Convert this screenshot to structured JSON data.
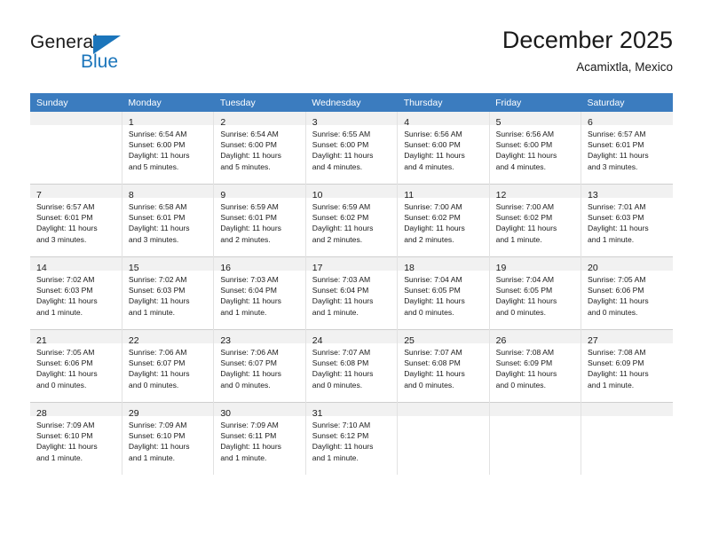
{
  "brand": {
    "name_top": "General",
    "name_bottom": "Blue",
    "accent_color": "#1b75bb"
  },
  "header": {
    "title": "December 2025",
    "subtitle": "Acamixtla, Mexico"
  },
  "theme": {
    "header_row_bg": "#3b7cbf",
    "header_row_text": "#ffffff",
    "daynum_band_bg": "#f1f1f1",
    "grid_line": "#e2e2e2"
  },
  "weekdays": [
    "Sunday",
    "Monday",
    "Tuesday",
    "Wednesday",
    "Thursday",
    "Friday",
    "Saturday"
  ],
  "weeks": [
    [
      {
        "day": "",
        "lines": []
      },
      {
        "day": "1",
        "lines": [
          "Sunrise: 6:54 AM",
          "Sunset: 6:00 PM",
          "Daylight: 11 hours",
          "and 5 minutes."
        ]
      },
      {
        "day": "2",
        "lines": [
          "Sunrise: 6:54 AM",
          "Sunset: 6:00 PM",
          "Daylight: 11 hours",
          "and 5 minutes."
        ]
      },
      {
        "day": "3",
        "lines": [
          "Sunrise: 6:55 AM",
          "Sunset: 6:00 PM",
          "Daylight: 11 hours",
          "and 4 minutes."
        ]
      },
      {
        "day": "4",
        "lines": [
          "Sunrise: 6:56 AM",
          "Sunset: 6:00 PM",
          "Daylight: 11 hours",
          "and 4 minutes."
        ]
      },
      {
        "day": "5",
        "lines": [
          "Sunrise: 6:56 AM",
          "Sunset: 6:00 PM",
          "Daylight: 11 hours",
          "and 4 minutes."
        ]
      },
      {
        "day": "6",
        "lines": [
          "Sunrise: 6:57 AM",
          "Sunset: 6:01 PM",
          "Daylight: 11 hours",
          "and 3 minutes."
        ]
      }
    ],
    [
      {
        "day": "7",
        "lines": [
          "Sunrise: 6:57 AM",
          "Sunset: 6:01 PM",
          "Daylight: 11 hours",
          "and 3 minutes."
        ]
      },
      {
        "day": "8",
        "lines": [
          "Sunrise: 6:58 AM",
          "Sunset: 6:01 PM",
          "Daylight: 11 hours",
          "and 3 minutes."
        ]
      },
      {
        "day": "9",
        "lines": [
          "Sunrise: 6:59 AM",
          "Sunset: 6:01 PM",
          "Daylight: 11 hours",
          "and 2 minutes."
        ]
      },
      {
        "day": "10",
        "lines": [
          "Sunrise: 6:59 AM",
          "Sunset: 6:02 PM",
          "Daylight: 11 hours",
          "and 2 minutes."
        ]
      },
      {
        "day": "11",
        "lines": [
          "Sunrise: 7:00 AM",
          "Sunset: 6:02 PM",
          "Daylight: 11 hours",
          "and 2 minutes."
        ]
      },
      {
        "day": "12",
        "lines": [
          "Sunrise: 7:00 AM",
          "Sunset: 6:02 PM",
          "Daylight: 11 hours",
          "and 1 minute."
        ]
      },
      {
        "day": "13",
        "lines": [
          "Sunrise: 7:01 AM",
          "Sunset: 6:03 PM",
          "Daylight: 11 hours",
          "and 1 minute."
        ]
      }
    ],
    [
      {
        "day": "14",
        "lines": [
          "Sunrise: 7:02 AM",
          "Sunset: 6:03 PM",
          "Daylight: 11 hours",
          "and 1 minute."
        ]
      },
      {
        "day": "15",
        "lines": [
          "Sunrise: 7:02 AM",
          "Sunset: 6:03 PM",
          "Daylight: 11 hours",
          "and 1 minute."
        ]
      },
      {
        "day": "16",
        "lines": [
          "Sunrise: 7:03 AM",
          "Sunset: 6:04 PM",
          "Daylight: 11 hours",
          "and 1 minute."
        ]
      },
      {
        "day": "17",
        "lines": [
          "Sunrise: 7:03 AM",
          "Sunset: 6:04 PM",
          "Daylight: 11 hours",
          "and 1 minute."
        ]
      },
      {
        "day": "18",
        "lines": [
          "Sunrise: 7:04 AM",
          "Sunset: 6:05 PM",
          "Daylight: 11 hours",
          "and 0 minutes."
        ]
      },
      {
        "day": "19",
        "lines": [
          "Sunrise: 7:04 AM",
          "Sunset: 6:05 PM",
          "Daylight: 11 hours",
          "and 0 minutes."
        ]
      },
      {
        "day": "20",
        "lines": [
          "Sunrise: 7:05 AM",
          "Sunset: 6:06 PM",
          "Daylight: 11 hours",
          "and 0 minutes."
        ]
      }
    ],
    [
      {
        "day": "21",
        "lines": [
          "Sunrise: 7:05 AM",
          "Sunset: 6:06 PM",
          "Daylight: 11 hours",
          "and 0 minutes."
        ]
      },
      {
        "day": "22",
        "lines": [
          "Sunrise: 7:06 AM",
          "Sunset: 6:07 PM",
          "Daylight: 11 hours",
          "and 0 minutes."
        ]
      },
      {
        "day": "23",
        "lines": [
          "Sunrise: 7:06 AM",
          "Sunset: 6:07 PM",
          "Daylight: 11 hours",
          "and 0 minutes."
        ]
      },
      {
        "day": "24",
        "lines": [
          "Sunrise: 7:07 AM",
          "Sunset: 6:08 PM",
          "Daylight: 11 hours",
          "and 0 minutes."
        ]
      },
      {
        "day": "25",
        "lines": [
          "Sunrise: 7:07 AM",
          "Sunset: 6:08 PM",
          "Daylight: 11 hours",
          "and 0 minutes."
        ]
      },
      {
        "day": "26",
        "lines": [
          "Sunrise: 7:08 AM",
          "Sunset: 6:09 PM",
          "Daylight: 11 hours",
          "and 0 minutes."
        ]
      },
      {
        "day": "27",
        "lines": [
          "Sunrise: 7:08 AM",
          "Sunset: 6:09 PM",
          "Daylight: 11 hours",
          "and 1 minute."
        ]
      }
    ],
    [
      {
        "day": "28",
        "lines": [
          "Sunrise: 7:09 AM",
          "Sunset: 6:10 PM",
          "Daylight: 11 hours",
          "and 1 minute."
        ]
      },
      {
        "day": "29",
        "lines": [
          "Sunrise: 7:09 AM",
          "Sunset: 6:10 PM",
          "Daylight: 11 hours",
          "and 1 minute."
        ]
      },
      {
        "day": "30",
        "lines": [
          "Sunrise: 7:09 AM",
          "Sunset: 6:11 PM",
          "Daylight: 11 hours",
          "and 1 minute."
        ]
      },
      {
        "day": "31",
        "lines": [
          "Sunrise: 7:10 AM",
          "Sunset: 6:12 PM",
          "Daylight: 11 hours",
          "and 1 minute."
        ]
      },
      {
        "day": "",
        "lines": []
      },
      {
        "day": "",
        "lines": []
      },
      {
        "day": "",
        "lines": []
      }
    ]
  ]
}
